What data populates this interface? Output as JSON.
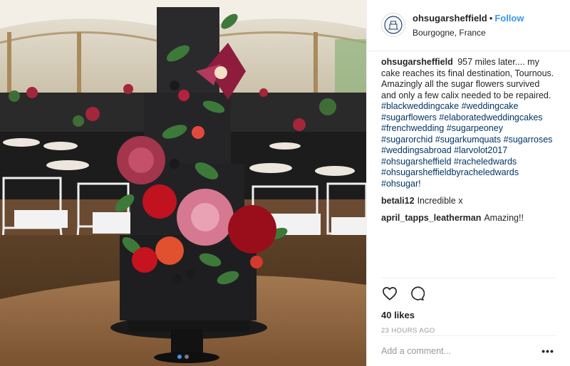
{
  "post": {
    "carousel": {
      "count": 2,
      "active": 1
    }
  },
  "header": {
    "username": "ohsugarsheffield",
    "separator": "•",
    "follow_label": "Follow",
    "location": "Bourgogne, France"
  },
  "caption": {
    "username": "ohsugarsheffield",
    "text": "957 miles later.... my cake reaches its final destination, Tournous. Amazingly all the sugar flowers survived and only a few calix needed to be repaired.",
    "hashtags": "#blackweddingcake #weddingcake #sugarflowers #elaboratedweddingcakes #frenchwedding #sugarpeoney #sugarorchid #sugarkumquats #sugarroses #weddingsabroad #larvolot2017 #ohsugarsheffield #racheledwards #ohsugarsheffieldbyracheledwards #ohsugar",
    "trailing": "!"
  },
  "comments": [
    {
      "username": "betali12",
      "text": "Incredible x"
    },
    {
      "username": "april_tapps_leatherman",
      "text": "Amazing!!"
    }
  ],
  "actions": {
    "like_icon": "heart-icon",
    "comment_icon": "speech-bubble-icon",
    "likes": "40 likes",
    "timestamp": "23 HOURS AGO"
  },
  "add_comment": {
    "placeholder": "Add a comment...",
    "more_label": "•••"
  },
  "colors": {
    "link": "#3897f0",
    "hashtag": "#003569",
    "muted": "#999999",
    "border": "#efefef"
  }
}
